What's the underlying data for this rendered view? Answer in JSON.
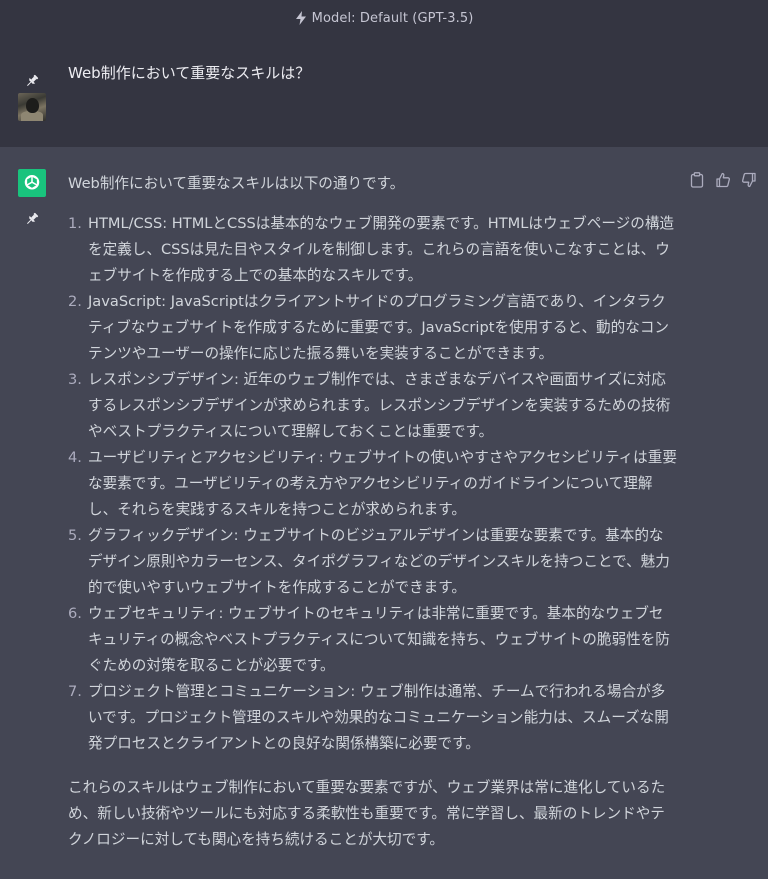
{
  "header": {
    "model_label": "Model: Default (GPT-3.5)"
  },
  "user_message": {
    "text": "Web制作において重要なスキルは？"
  },
  "assistant_message": {
    "intro": "Web制作において重要なスキルは以下の通りです。",
    "items": [
      {
        "number": "1.",
        "text": "HTML/CSS: HTMLとCSSは基本的なウェブ開発の要素です。HTMLはウェブページの構造を定義し、CSSは見た目やスタイルを制御します。これらの言語を使いこなすことは、ウェブサイトを作成する上での基本的なスキルです。"
      },
      {
        "number": "2.",
        "text": "JavaScript: JavaScriptはクライアントサイドのプログラミング言語であり、インタラクティブなウェブサイトを作成するために重要です。JavaScriptを使用すると、動的なコンテンツやユーザーの操作に応じた振る舞いを実装することができます。"
      },
      {
        "number": "3.",
        "text": "レスポンシブデザイン: 近年のウェブ制作では、さまざまなデバイスや画面サイズに対応するレスポンシブデザインが求められます。レスポンシブデザインを実装するための技術やベストプラクティスについて理解しておくことは重要です。"
      },
      {
        "number": "4.",
        "text": "ユーザビリティとアクセシビリティ: ウェブサイトの使いやすさやアクセシビリティは重要な要素です。ユーザビリティの考え方やアクセシビリティのガイドラインについて理解し、それらを実践するスキルを持つことが求められます。"
      },
      {
        "number": "5.",
        "text": "グラフィックデザイン: ウェブサイトのビジュアルデザインは重要な要素です。基本的なデザイン原則やカラーセンス、タイポグラフィなどのデザインスキルを持つことで、魅力的で使いやすいウェブサイトを作成することができます。"
      },
      {
        "number": "6.",
        "text": "ウェブセキュリティ: ウェブサイトのセキュリティは非常に重要です。基本的なウェブセキュリティの概念やベストプラクティスについて知識を持ち、ウェブサイトの脆弱性を防ぐための対策を取ることが必要です。"
      },
      {
        "number": "7.",
        "text": "プロジェクト管理とコミュニケーション: ウェブ制作は通常、チームで行われる場合が多いです。プロジェクト管理のスキルや効果的なコミュニケーション能力は、スムーズな開発プロセスとクライアントとの良好な関係構築に必要です。"
      }
    ],
    "outro": "これらのスキルはウェブ制作において重要な要素ですが、ウェブ業界は常に進化しているため、新しい技術やツールにも対応する柔軟性も重要です。常に学習し、最新のトレンドやテクノロジーに対しても関心を持ち続けることが大切です。"
  },
  "icons": {
    "header": "lightning-bolt-icon",
    "pin": "pin-icon",
    "gpt_avatar": "openai-logo-icon",
    "copy": "clipboard-icon",
    "like": "thumbs-up-icon",
    "dislike": "thumbs-down-icon"
  },
  "colors": {
    "header_bg": "#343541",
    "assistant_bg": "#444654",
    "gpt_avatar": "#19c37d",
    "text": "#d1d5db"
  }
}
